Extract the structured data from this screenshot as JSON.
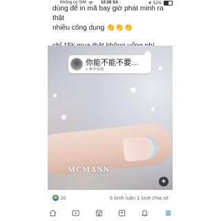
{
  "status_bar": {
    "carrier": "Không có SIM",
    "time": "10:28 SA",
    "battery_percent": "52%",
    "battery_level": 0.52
  },
  "post": {
    "text_line1": "dùng để in mã bay giờ phát minh ra thật",
    "text_line2": "nhiều công dụng",
    "emoji": "👏👏👏",
    "text_line3": "chỉ 15k mua thật không uống phí"
  },
  "video": {
    "caption_title": "你能不能不要…",
    "caption_sub": "# 美甲姐姐",
    "watermark": "MCMANN",
    "add_label": "+"
  },
  "stats": {
    "likes": "16",
    "comments_shares": "6 bình luận  1 lượt chia sẻ"
  },
  "nav": {
    "items": [
      "home-icon",
      "video-icon",
      "marketplace-icon",
      "groups-icon",
      "bell-icon",
      "menu-icon"
    ],
    "accent": "#1877f2"
  }
}
